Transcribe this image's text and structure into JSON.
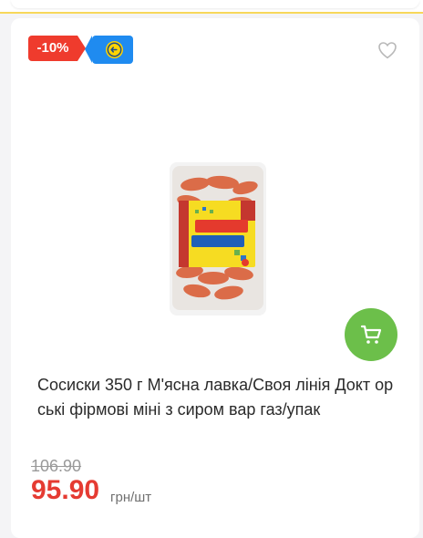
{
  "product": {
    "discount_label": "-10%",
    "promo_icon": "coin-arrow-icon",
    "favorite_icon": "heart-icon",
    "image_icon": "sausage-package-image",
    "cart_icon": "cart-icon",
    "title": "Сосиски 350 г М'ясна лавка/Своя лінія Докт орські фірмові міні з сиром вар газ/упак",
    "old_price": "106.90",
    "price": "95.90",
    "price_unit": "грн/шт"
  },
  "colors": {
    "discount": "#ef3b2d",
    "promo": "#1f8bf0",
    "cart": "#6cbf4a",
    "price": "#e53b32"
  }
}
